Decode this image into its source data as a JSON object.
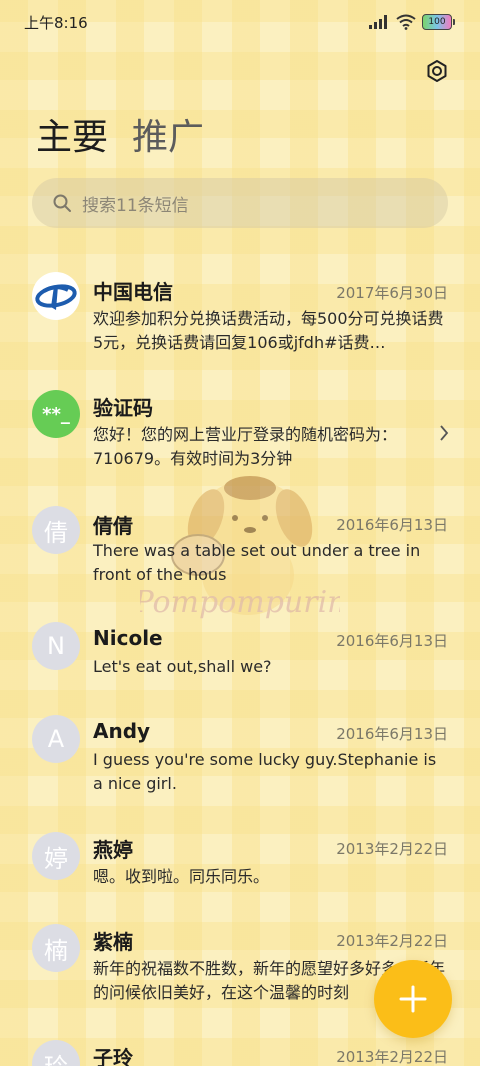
{
  "status_bar": {
    "time": "上午8:16",
    "battery": "100"
  },
  "tabs": [
    {
      "label": "主要"
    },
    {
      "label": "推广"
    }
  ],
  "search": {
    "placeholder": "搜索11条短信"
  },
  "messages": [
    {
      "name": "中国电信",
      "date": "2017年6月30日",
      "preview": "欢迎参加积分兑换话费活动，每500分可兑换话费5元，兑换话费请回复106或jfdh#话费…",
      "avatar_style": "telecom-logo"
    },
    {
      "name": "验证码",
      "date": "",
      "preview": "您好！您的网上营业厅登录的随机密码为：710679。有效时间为3分钟",
      "avatar_text": "**_",
      "avatar_color": "#66cc55"
    },
    {
      "name": "倩倩",
      "date": "2016年6月13日",
      "preview": "There was a table set out under a tree in front of the hous",
      "avatar_text": "倩"
    },
    {
      "name": "Nicole",
      "date": "2016年6月13日",
      "preview": "Let's eat out,shall we?",
      "avatar_text": "N"
    },
    {
      "name": "Andy",
      "date": "2016年6月13日",
      "preview": "I guess you're some lucky guy.Stephanie is a nice girl.",
      "avatar_text": "A"
    },
    {
      "name": "燕婷",
      "date": "2013年2月22日",
      "preview": "嗯。收到啦。同乐同乐。",
      "avatar_text": "婷"
    },
    {
      "name": "紫楠",
      "date": "2013年2月22日",
      "preview": "新年的祝福数不胜数，新年的愿望好多好多，新年的问候依旧美好，在这个温馨的时刻",
      "avatar_text": "楠"
    },
    {
      "name": "子玲",
      "date": "2013年2月22日",
      "preview": "",
      "avatar_text": "玲"
    }
  ],
  "mascot": {
    "label": "Pompompurin"
  },
  "colors": {
    "accent": "#fbbe18",
    "background": "#fbf0c0",
    "verify_avatar": "#66cc55"
  },
  "icons": [
    "settings-icon",
    "search-icon",
    "chevron-right-icon",
    "plus-icon"
  ]
}
